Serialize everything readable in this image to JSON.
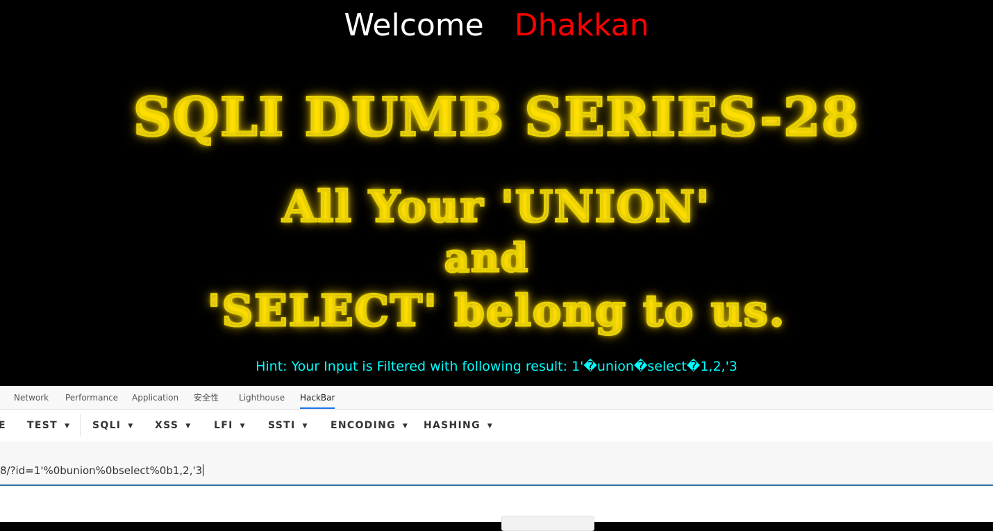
{
  "page": {
    "welcome": "Welcome",
    "user": "Dhakkan",
    "title": "SQLI DUMB SERIES-28",
    "line1": "All Your 'UNION'",
    "line2": "and",
    "line3": "'SELECT' belong to us.",
    "hint": "Hint: Your Input is Filtered with following result: 1'�union�select�1,2,'3"
  },
  "devtools": {
    "tabs": [
      "Network",
      "Performance",
      "Application",
      "安全性",
      "Lighthouse",
      "HackBar"
    ],
    "active_tab": "HackBar",
    "toolbar": [
      "E",
      "TEST",
      "SQLI",
      "XSS",
      "LFI",
      "SSTI",
      "ENCODING",
      "HASHING"
    ],
    "url": "8/?id=1'%0bunion%0bselect%0b1,2,'3"
  },
  "colors": {
    "user": "#ff0000",
    "hint": "#00ffff",
    "banner_outline": "#e9d200",
    "active_tab_underline": "#1a73e8",
    "url_underline": "#2e6fa8"
  }
}
